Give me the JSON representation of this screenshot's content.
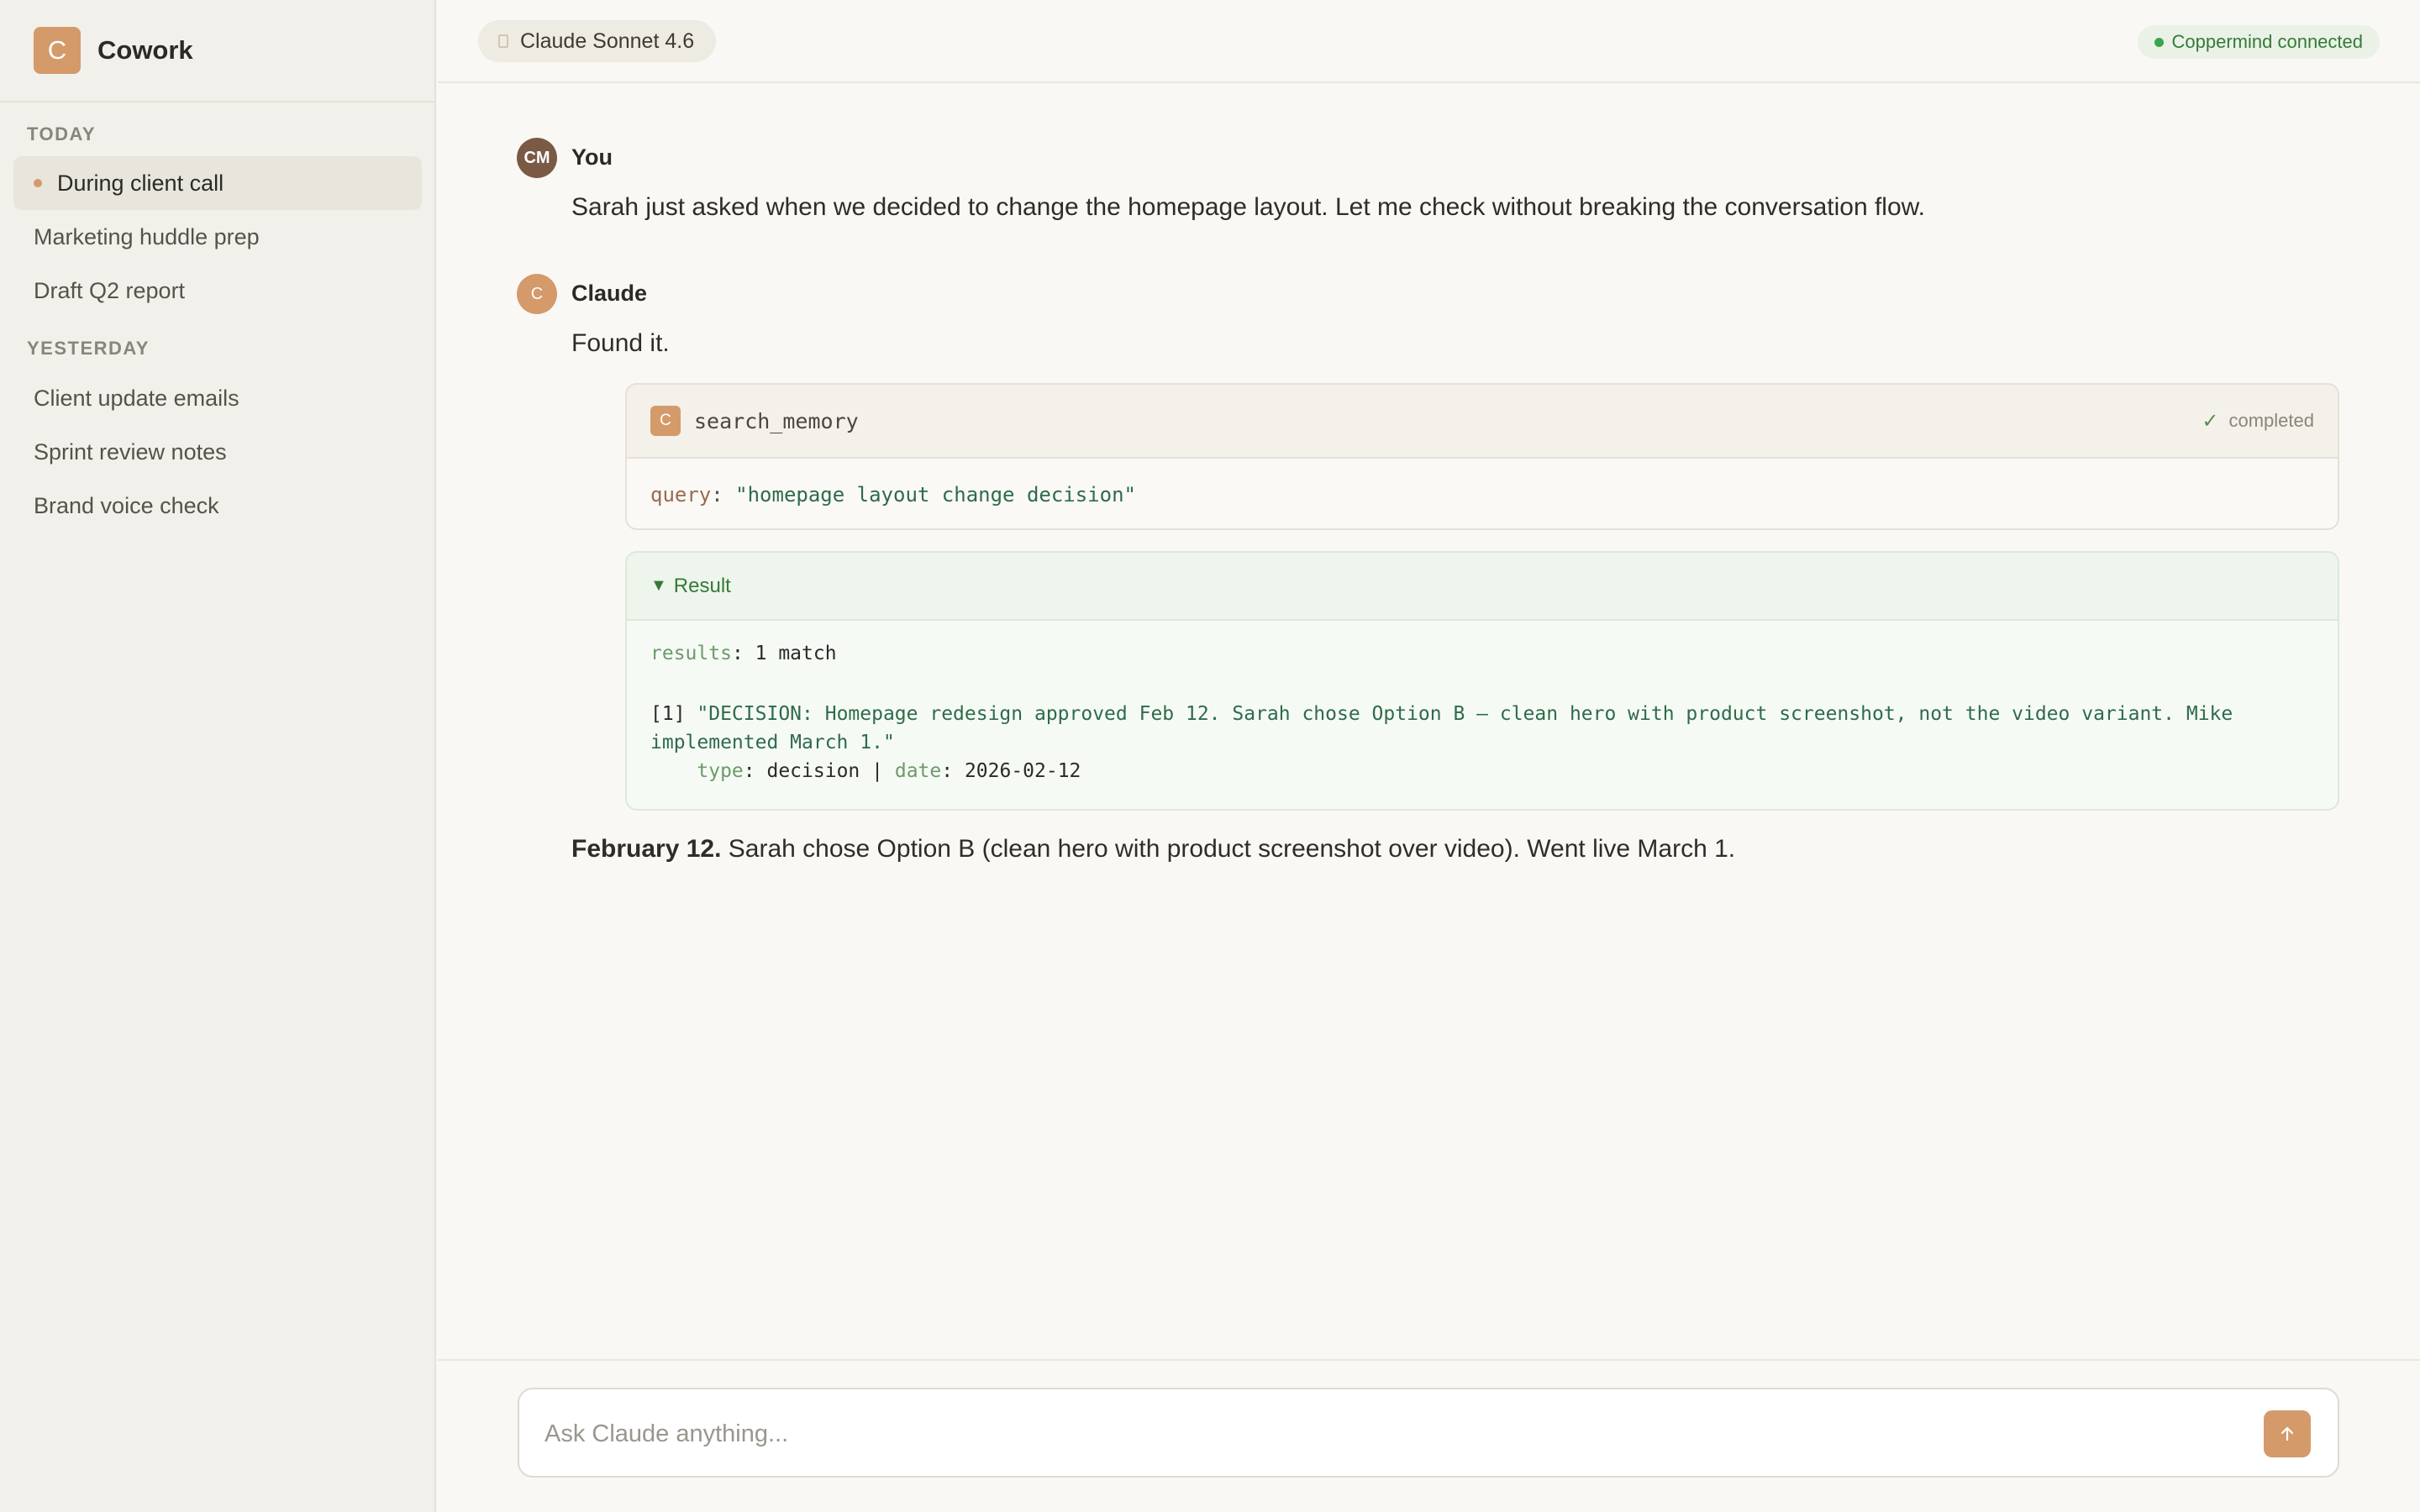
{
  "sidebar": {
    "brand": {
      "logo_letter": "C",
      "name": "Cowork"
    },
    "sections": [
      {
        "label": "TODAY",
        "items": [
          "During client call",
          "Marketing huddle prep",
          "Draft Q2 report"
        ]
      },
      {
        "label": "YESTERDAY",
        "items": [
          "Client update emails",
          "Sprint review notes",
          "Brand voice check"
        ]
      }
    ],
    "active_item": "During client call"
  },
  "header": {
    "model": "Claude Sonnet 4.6",
    "connection_status": "Coppermind connected"
  },
  "conversation": {
    "user": {
      "avatar_initials": "CM",
      "name": "You",
      "message": "Sarah just asked when we decided to change the homepage layout. Let me check without breaking the conversation flow."
    },
    "assistant": {
      "avatar_letter": "C",
      "name": "Claude",
      "intro": "Found it.",
      "tool_call": {
        "icon_letter": "C",
        "name": "search_memory",
        "status": "completed",
        "param_key": "query",
        "param_value": "\"homepage layout change decision\""
      },
      "result": {
        "header": "Result",
        "results_key": "results",
        "results_value": "1 match",
        "match_index": "[1]",
        "match_text_line1": "\"DECISION: Homepage redesign approved Feb 12. Sarah chose Option B — clean hero with product screenshot, not the video variant. Mike",
        "match_text_line2": "implemented March 1.\"",
        "type_key": "type",
        "type_value": "decision",
        "separator": "|",
        "date_key": "date",
        "date_value": "2026-02-12"
      },
      "final_bold": "February 12.",
      "final_text": "Sarah chose Option B (clean hero with product screenshot over video). Went live March 1."
    }
  },
  "composer": {
    "placeholder": "Ask Claude anything..."
  },
  "colors": {
    "accent": "#d49a6a",
    "status_green": "#357a38",
    "sidebar_bg": "#f2f0ea",
    "main_bg": "#f9f8f5"
  },
  "icons": [
    "send-arrow-icon",
    "check-icon",
    "caret-down-icon",
    "status-dot-icon",
    "model-icon"
  ]
}
